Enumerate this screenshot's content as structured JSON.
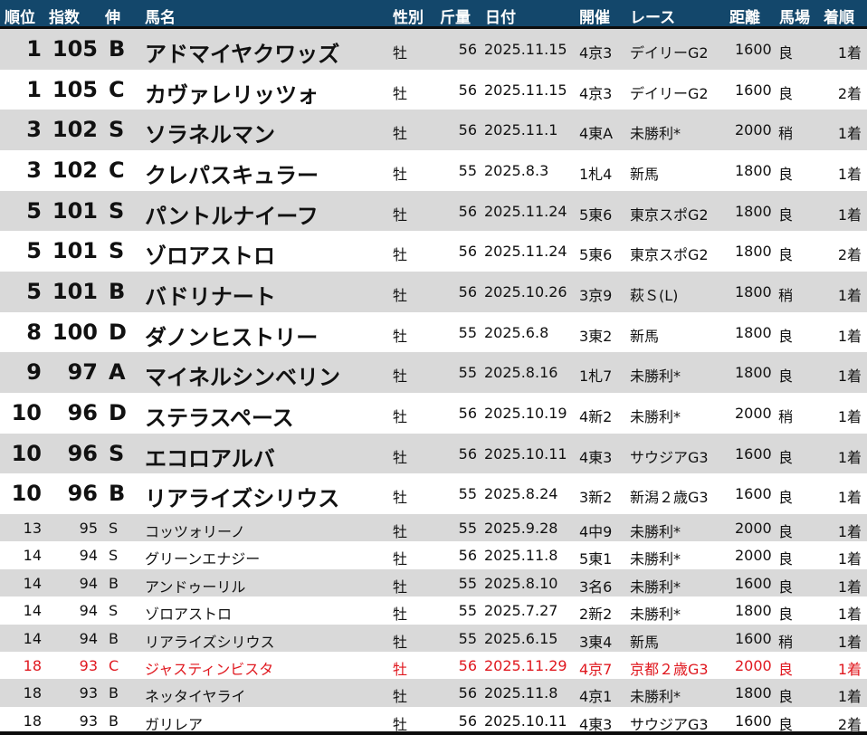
{
  "header": {
    "rank": "順位",
    "index": "指数",
    "nobi": "伸",
    "name": "馬名",
    "sex": "性別",
    "kinryo": "斤量",
    "date": "日付",
    "kaisai": "開催",
    "race": "レース",
    "distance": "距離",
    "baba": "馬場",
    "chakujun": "着順"
  },
  "colors": {
    "header_bg": "#13476b",
    "shade": "#d9d9d9",
    "highlight_text": "#e0181f"
  },
  "rows": [
    {
      "rank": "1",
      "index": "105",
      "nobi": "B",
      "name": "アドマイヤクワッズ",
      "sex": "牡",
      "kinryo": "56",
      "date": "2025.11.15",
      "kaisai": "4京3",
      "race": "デイリーG2",
      "distance": "1600",
      "baba": "良",
      "chakujun": "1着"
    },
    {
      "rank": "1",
      "index": "105",
      "nobi": "C",
      "name": "カヴァレリッツォ",
      "sex": "牡",
      "kinryo": "56",
      "date": "2025.11.15",
      "kaisai": "4京3",
      "race": "デイリーG2",
      "distance": "1600",
      "baba": "良",
      "chakujun": "2着"
    },
    {
      "rank": "3",
      "index": "102",
      "nobi": "S",
      "name": "ソラネルマン",
      "sex": "牡",
      "kinryo": "56",
      "date": "2025.11.1",
      "kaisai": "4東A",
      "race": "未勝利*",
      "distance": "2000",
      "baba": "稍",
      "chakujun": "1着"
    },
    {
      "rank": "3",
      "index": "102",
      "nobi": "C",
      "name": "クレパスキュラー",
      "sex": "牡",
      "kinryo": "55",
      "date": "2025.8.3",
      "kaisai": "1札4",
      "race": "新馬",
      "distance": "1800",
      "baba": "良",
      "chakujun": "1着"
    },
    {
      "rank": "5",
      "index": "101",
      "nobi": "S",
      "name": "パントルナイーフ",
      "sex": "牡",
      "kinryo": "56",
      "date": "2025.11.24",
      "kaisai": "5東6",
      "race": "東京スポG2",
      "distance": "1800",
      "baba": "良",
      "chakujun": "1着"
    },
    {
      "rank": "5",
      "index": "101",
      "nobi": "S",
      "name": "ゾロアストロ",
      "sex": "牡",
      "kinryo": "56",
      "date": "2025.11.24",
      "kaisai": "5東6",
      "race": "東京スポG2",
      "distance": "1800",
      "baba": "良",
      "chakujun": "2着"
    },
    {
      "rank": "5",
      "index": "101",
      "nobi": "B",
      "name": "バドリナート",
      "sex": "牡",
      "kinryo": "56",
      "date": "2025.10.26",
      "kaisai": "3京9",
      "race": "萩Ｓ(L)",
      "distance": "1800",
      "baba": "稍",
      "chakujun": "1着"
    },
    {
      "rank": "8",
      "index": "100",
      "nobi": "D",
      "name": "ダノンヒストリー",
      "sex": "牡",
      "kinryo": "55",
      "date": "2025.6.8",
      "kaisai": "3東2",
      "race": "新馬",
      "distance": "1800",
      "baba": "良",
      "chakujun": "1着"
    },
    {
      "rank": "9",
      "index": "97",
      "nobi": "A",
      "name": "マイネルシンベリン",
      "sex": "牡",
      "kinryo": "55",
      "date": "2025.8.16",
      "kaisai": "1札7",
      "race": "未勝利*",
      "distance": "1800",
      "baba": "良",
      "chakujun": "1着"
    },
    {
      "rank": "10",
      "index": "96",
      "nobi": "D",
      "name": "ステラスペース",
      "sex": "牡",
      "kinryo": "56",
      "date": "2025.10.19",
      "kaisai": "4新2",
      "race": "未勝利*",
      "distance": "2000",
      "baba": "稍",
      "chakujun": "1着"
    },
    {
      "rank": "10",
      "index": "96",
      "nobi": "S",
      "name": "エコロアルバ",
      "sex": "牡",
      "kinryo": "56",
      "date": "2025.10.11",
      "kaisai": "4東3",
      "race": "サウジアG3",
      "distance": "1600",
      "baba": "良",
      "chakujun": "1着"
    },
    {
      "rank": "10",
      "index": "96",
      "nobi": "B",
      "name": "リアライズシリウス",
      "sex": "牡",
      "kinryo": "55",
      "date": "2025.8.24",
      "kaisai": "3新2",
      "race": "新潟２歳G3",
      "distance": "1600",
      "baba": "良",
      "chakujun": "1着"
    },
    {
      "rank": "13",
      "index": "95",
      "nobi": "S",
      "name": "コッツォリーノ",
      "sex": "牡",
      "kinryo": "55",
      "date": "2025.9.28",
      "kaisai": "4中9",
      "race": "未勝利*",
      "distance": "2000",
      "baba": "良",
      "chakujun": "1着"
    },
    {
      "rank": "14",
      "index": "94",
      "nobi": "S",
      "name": "グリーンエナジー",
      "sex": "牡",
      "kinryo": "56",
      "date": "2025.11.8",
      "kaisai": "5東1",
      "race": "未勝利*",
      "distance": "2000",
      "baba": "良",
      "chakujun": "1着"
    },
    {
      "rank": "14",
      "index": "94",
      "nobi": "B",
      "name": "アンドゥーリル",
      "sex": "牡",
      "kinryo": "55",
      "date": "2025.8.10",
      "kaisai": "3名6",
      "race": "未勝利*",
      "distance": "1600",
      "baba": "良",
      "chakujun": "1着"
    },
    {
      "rank": "14",
      "index": "94",
      "nobi": "S",
      "name": "ゾロアストロ",
      "sex": "牡",
      "kinryo": "55",
      "date": "2025.7.27",
      "kaisai": "2新2",
      "race": "未勝利*",
      "distance": "1800",
      "baba": "良",
      "chakujun": "1着"
    },
    {
      "rank": "14",
      "index": "94",
      "nobi": "B",
      "name": "リアライズシリウス",
      "sex": "牡",
      "kinryo": "55",
      "date": "2025.6.15",
      "kaisai": "3東4",
      "race": "新馬",
      "distance": "1600",
      "baba": "稍",
      "chakujun": "1着"
    },
    {
      "rank": "18",
      "index": "93",
      "nobi": "C",
      "name": "ジャスティンビスタ",
      "sex": "牡",
      "kinryo": "56",
      "date": "2025.11.29",
      "kaisai": "4京7",
      "race": "京都２歳G3",
      "distance": "2000",
      "baba": "良",
      "chakujun": "1着",
      "highlight": true
    },
    {
      "rank": "18",
      "index": "93",
      "nobi": "B",
      "name": "ネッタイヤライ",
      "sex": "牡",
      "kinryo": "56",
      "date": "2025.11.8",
      "kaisai": "4京1",
      "race": "未勝利*",
      "distance": "1800",
      "baba": "良",
      "chakujun": "1着"
    },
    {
      "rank": "18",
      "index": "93",
      "nobi": "B",
      "name": "ガリレア",
      "sex": "牡",
      "kinryo": "56",
      "date": "2025.10.11",
      "kaisai": "4東3",
      "race": "サウジアG3",
      "distance": "1600",
      "baba": "良",
      "chakujun": "2着"
    }
  ]
}
